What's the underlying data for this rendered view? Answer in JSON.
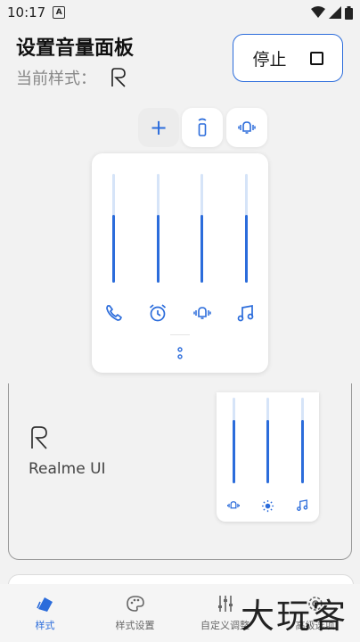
{
  "status_bar": {
    "time": "10:17",
    "notification": "A"
  },
  "header": {
    "title": "设置音量面板",
    "subtitle": "当前样式："
  },
  "stop_button": {
    "label": "停止"
  },
  "panel": {
    "sliders": [
      {
        "name": "call",
        "level": 0.62
      },
      {
        "name": "alarm",
        "level": 0.62
      },
      {
        "name": "ring",
        "level": 0.62
      },
      {
        "name": "media",
        "level": 0.62
      }
    ],
    "icons": [
      "phone-icon",
      "alarm-icon",
      "vibrate-icon",
      "music-note-icon"
    ]
  },
  "style_card": {
    "label": "Realme UI",
    "mini_sliders": [
      {
        "level": 0.74
      },
      {
        "level": 0.74
      },
      {
        "level": 0.74
      }
    ]
  },
  "nav": {
    "items": [
      {
        "label": "样式",
        "icon": "style-icon"
      },
      {
        "label": "样式设置",
        "icon": "palette-icon"
      },
      {
        "label": "自定义调整",
        "icon": "sliders-icon"
      },
      {
        "label": "高级选项",
        "icon": "gear-icon"
      }
    ]
  },
  "watermark": "大玩客",
  "colors": {
    "accent": "#2b6cdb",
    "track": "#d6e4f8"
  }
}
